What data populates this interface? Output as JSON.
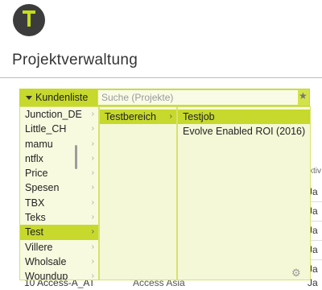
{
  "header": {
    "title": "Projektverwaltung"
  },
  "picker": {
    "dropdown_label": "Kundenliste",
    "search_placeholder": "Suche (Projekte)",
    "customers": [
      {
        "label": "Junction_DE"
      },
      {
        "label": "Little_CH"
      },
      {
        "label": "mamu"
      },
      {
        "label": "ntflx"
      },
      {
        "label": "Price"
      },
      {
        "label": "Spesen"
      },
      {
        "label": "TBX"
      },
      {
        "label": "Teks"
      },
      {
        "label": "Test"
      },
      {
        "label": "Villere"
      },
      {
        "label": "Wholsale"
      },
      {
        "label": "Woundup"
      }
    ],
    "areas": [
      {
        "label": "Testbereich"
      }
    ],
    "jobs": [
      {
        "label": "Testjob"
      },
      {
        "label": "Evolve Enabled ROI (2016)"
      }
    ]
  },
  "background": {
    "row_number": "10",
    "row_code": "Access-A_AT",
    "row_client": "Access Asia",
    "col_header_fragment": "ktiv",
    "ja": "Ja"
  },
  "icons": {
    "logo": "t-logo-icon",
    "star": "star-icon",
    "gear": "gear-icon"
  },
  "colors": {
    "accent": "#c6d92c",
    "panel": "#f5f8d6"
  }
}
